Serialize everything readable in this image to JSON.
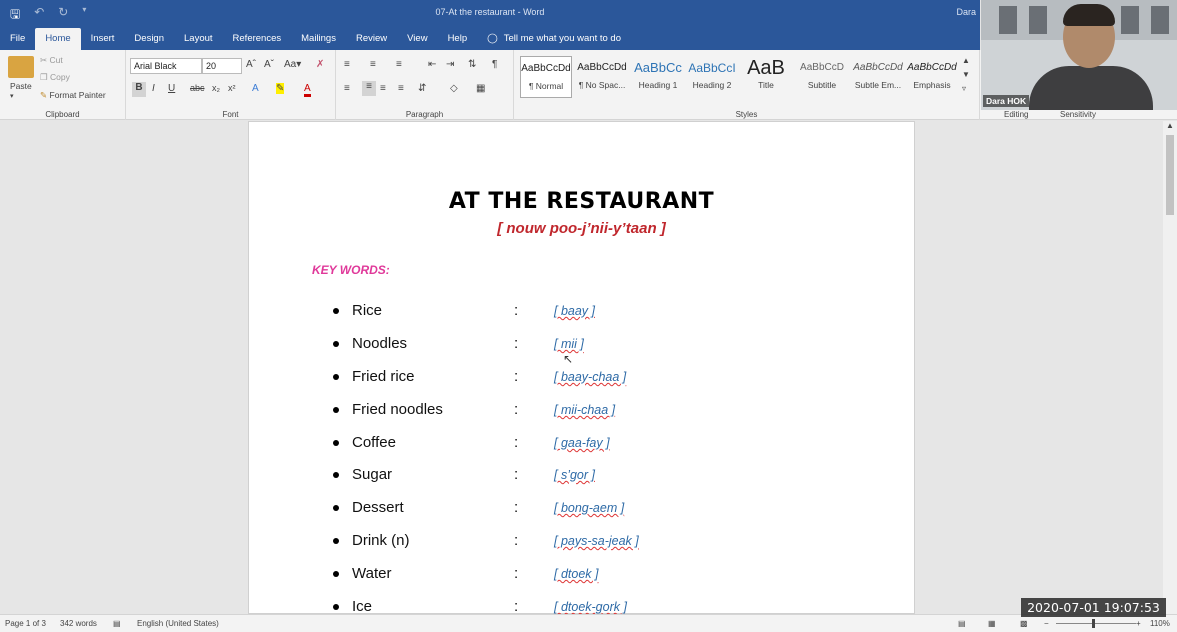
{
  "window": {
    "title": "07-At the restaurant  -  Word",
    "user": "Dara"
  },
  "quick_access": {
    "save_icon": "save-icon",
    "undo_icon": "undo-icon",
    "redo_icon": "redo-icon"
  },
  "tabs": [
    {
      "label": "File"
    },
    {
      "label": "Home",
      "active": true
    },
    {
      "label": "Insert"
    },
    {
      "label": "Design"
    },
    {
      "label": "Layout"
    },
    {
      "label": "References"
    },
    {
      "label": "Mailings"
    },
    {
      "label": "Review"
    },
    {
      "label": "View"
    },
    {
      "label": "Help"
    }
  ],
  "tell_me": "Tell me what you want to do",
  "ribbon": {
    "clipboard": {
      "paste": "Paste",
      "cut": "Cut",
      "copy": "Copy",
      "format_painter": "Format Painter",
      "group": "Clipboard"
    },
    "font": {
      "name": "Arial Black",
      "size": "20",
      "group": "Font"
    },
    "paragraph": {
      "group": "Paragraph"
    },
    "styles": {
      "group": "Styles",
      "items": [
        {
          "preview": "AaBbCcDd",
          "name": "¶ Normal"
        },
        {
          "preview": "AaBbCcDd",
          "name": "¶ No Spac..."
        },
        {
          "preview": "AaBbCc",
          "name": "Heading 1"
        },
        {
          "preview": "AaBbCcI",
          "name": "Heading 2"
        },
        {
          "preview": "AaB",
          "name": "Title"
        },
        {
          "preview": "AaBbCcD",
          "name": "Subtitle"
        },
        {
          "preview": "AaBbCcDd",
          "name": "Subtle Em..."
        },
        {
          "preview": "AaBbCcDd",
          "name": "Emphasis"
        }
      ]
    },
    "editing": "Editing",
    "sensitivity": "Sensitivity"
  },
  "document": {
    "title": "AT THE RESTAURANT",
    "subtitle": "[ nouw  poo-j’nii-y’taan ]",
    "keywords_label": "KEY WORDS:",
    "items": [
      {
        "word": "Rice",
        "colon": ":",
        "pron": "[ baay ]"
      },
      {
        "word": "Noodles",
        "colon": ":",
        "pron": "[ mii ]"
      },
      {
        "word": "Fried rice",
        "colon": ":",
        "pron": "[ baay-chaa ]"
      },
      {
        "word": "Fried noodles",
        "colon": ":",
        "pron": "[ mii-chaa ]"
      },
      {
        "word": "Coffee",
        "colon": ":",
        "pron": "[ gaa-fay ]"
      },
      {
        "word": "Sugar",
        "colon": ":",
        "pron": "[ s’gor ]"
      },
      {
        "word": "Dessert",
        "colon": ":",
        "pron": "[ bong-aem ]"
      },
      {
        "word": "Drink (n)",
        "colon": ":",
        "pron": "[ pays-sa-jeak ]"
      },
      {
        "word": "Water",
        "colon": ":",
        "pron": "[ dtoek ]"
      },
      {
        "word": "Ice",
        "colon": ":",
        "pron": "[ dtoek-gork ]"
      }
    ]
  },
  "status": {
    "page": "Page 1 of 3",
    "words": "342 words",
    "language": "English (United States)",
    "zoom": "110%"
  },
  "webcam": {
    "name": "Dara HOK"
  },
  "timestamp": "2020-07-01  19:07:53"
}
